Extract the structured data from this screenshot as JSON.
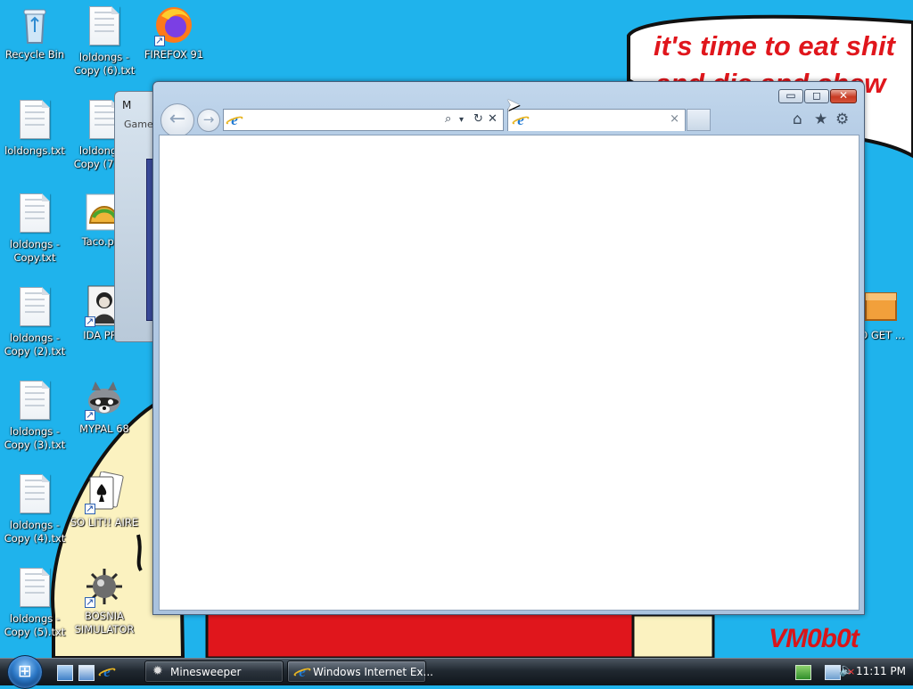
{
  "wallpaper": {
    "line1": "it's time to eat shit",
    "line2": "and die and chew",
    "signature": "VM0b0t",
    "colors": {
      "sky": "#1fb3ec",
      "blob": "#fbf2c0",
      "red": "#e0161c"
    }
  },
  "desktop_icons": [
    {
      "label": "Recycle Bin",
      "icon": "recycle-bin-icon"
    },
    {
      "label": "loldongs - Copy (6).txt",
      "icon": "text-file-icon"
    },
    {
      "label": "FIREFOX 91",
      "icon": "firefox-icon"
    },
    {
      "label": "loldongs.txt",
      "icon": "text-file-icon"
    },
    {
      "label": "loldongs - Copy (7).txt",
      "icon": "text-file-icon"
    },
    {
      "label": "loldongs - Copy.txt",
      "icon": "text-file-icon"
    },
    {
      "label": "Taco.png",
      "icon": "taco-image-icon"
    },
    {
      "label": "loldongs - Copy (2).txt",
      "icon": "text-file-icon"
    },
    {
      "label": "IDA PRO",
      "icon": "ida-pro-icon"
    },
    {
      "label": "loldongs - Copy (3).txt",
      "icon": "text-file-icon"
    },
    {
      "label": "MYPAL 68",
      "icon": "mypal-raccoon-icon"
    },
    {
      "label": "loldongs - Copy (4).txt",
      "icon": "text-file-icon"
    },
    {
      "label": "SO LIT!! AIRE",
      "icon": "solitaire-cards-icon"
    },
    {
      "label": "loldongs - Copy (5).txt",
      "icon": "text-file-icon"
    },
    {
      "label": "BOSNIA SIMULATOR",
      "icon": "mine-icon"
    },
    {
      "label": "GO GET ...",
      "icon": "folder-box-icon"
    }
  ],
  "minesweeper_window": {
    "title": "M",
    "menu": "Game"
  },
  "ie_window": {
    "title_buttons": {
      "minimize": "▭",
      "maximize": "◻",
      "close": "✕"
    },
    "back_icon": "←",
    "forward_icon": "→",
    "address_value": "",
    "address_tools": {
      "search": "⌕",
      "dropdown": "▾",
      "refresh": "↻",
      "stop": "✕"
    },
    "tab_title": "",
    "tab_close": "×",
    "command_icons": {
      "home": "⌂",
      "favorites": "★",
      "tools": "⚙"
    },
    "accent": "#1e78d2"
  },
  "taskbar": {
    "tasks": [
      {
        "label": "Minesweeper",
        "icon": "minesweeper-icon"
      },
      {
        "label": "Windows Internet Ex...",
        "icon": "ie-icon"
      }
    ],
    "clock": "11:11 PM",
    "volume_icon": "🔈"
  }
}
